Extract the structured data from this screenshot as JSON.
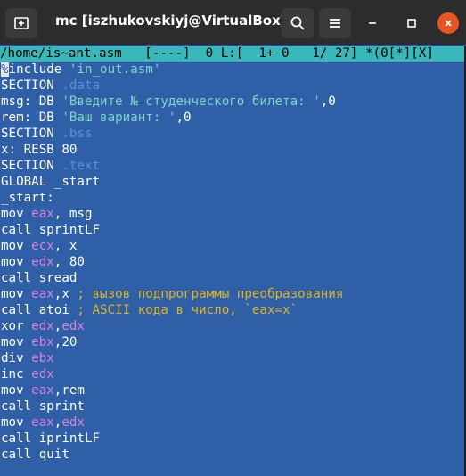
{
  "window": {
    "title": "mc [iszhukovskiyj@VirtualBox]:...",
    "colors": {
      "titlebar": "#2c2c2c",
      "terminal_bg": "#2f5fa6",
      "status_bg": "#3ab7b9",
      "close_btn": "#e95420"
    }
  },
  "titlebar": {
    "new_tab_icon": "new-tab-icon",
    "search_icon": "search-icon",
    "menu_icon": "hamburger-menu-icon",
    "minimize_icon": "minimize-icon",
    "maximize_icon": "maximize-icon",
    "close_icon": "close-icon"
  },
  "editor": {
    "status_line": "/home/is~ant.asm   [----]  0 L:[  1+ 0   1/ 27] *(0[*][X]",
    "lines": [
      [
        {
          "t": "%",
          "c": "cursor"
        },
        {
          "t": "include ",
          "c": "text"
        },
        {
          "t": "'in_out.asm'",
          "c": "str"
        }
      ],
      [
        {
          "t": "SECTION ",
          "c": "text"
        },
        {
          "t": ".data",
          "c": "dir"
        }
      ],
      [
        {
          "t": "msg: DB ",
          "c": "text"
        },
        {
          "t": "'Введите № студенческого билета: '",
          "c": "str"
        },
        {
          "t": ",0",
          "c": "text"
        }
      ],
      [
        {
          "t": "rem: DB ",
          "c": "text"
        },
        {
          "t": "'Ваш вариант: '",
          "c": "str"
        },
        {
          "t": ",0",
          "c": "text"
        }
      ],
      [
        {
          "t": "SECTION ",
          "c": "text"
        },
        {
          "t": ".bss",
          "c": "dir"
        }
      ],
      [
        {
          "t": "x: RESB 80",
          "c": "text"
        }
      ],
      [
        {
          "t": "SECTION ",
          "c": "text"
        },
        {
          "t": ".text",
          "c": "dir"
        }
      ],
      [
        {
          "t": "GLOBAL _start",
          "c": "text"
        }
      ],
      [
        {
          "t": "_start:",
          "c": "text"
        }
      ],
      [
        {
          "t": "mov ",
          "c": "text"
        },
        {
          "t": "eax",
          "c": "reg"
        },
        {
          "t": ", msg",
          "c": "text"
        }
      ],
      [
        {
          "t": "call sprintLF",
          "c": "text"
        }
      ],
      [
        {
          "t": "mov ",
          "c": "text"
        },
        {
          "t": "ecx",
          "c": "reg"
        },
        {
          "t": ", x",
          "c": "text"
        }
      ],
      [
        {
          "t": "mov ",
          "c": "text"
        },
        {
          "t": "edx",
          "c": "reg"
        },
        {
          "t": ", 80",
          "c": "text"
        }
      ],
      [
        {
          "t": "call sread",
          "c": "text"
        }
      ],
      [
        {
          "t": "mov ",
          "c": "text"
        },
        {
          "t": "eax",
          "c": "reg"
        },
        {
          "t": ",x ",
          "c": "text"
        },
        {
          "t": "; вызов подпрограммы преобразования",
          "c": "com"
        }
      ],
      [
        {
          "t": "call atoi ",
          "c": "text"
        },
        {
          "t": "; ASCII кода в число, `eax=x`",
          "c": "com"
        }
      ],
      [
        {
          "t": "xor ",
          "c": "text"
        },
        {
          "t": "edx",
          "c": "reg"
        },
        {
          "t": ",",
          "c": "text"
        },
        {
          "t": "edx",
          "c": "reg"
        }
      ],
      [
        {
          "t": "mov ",
          "c": "text"
        },
        {
          "t": "ebx",
          "c": "reg"
        },
        {
          "t": ",20",
          "c": "text"
        }
      ],
      [
        {
          "t": "div ",
          "c": "text"
        },
        {
          "t": "ebx",
          "c": "reg"
        }
      ],
      [
        {
          "t": "inc ",
          "c": "text"
        },
        {
          "t": "edx",
          "c": "reg"
        }
      ],
      [
        {
          "t": "mov ",
          "c": "text"
        },
        {
          "t": "eax",
          "c": "reg"
        },
        {
          "t": ",rem",
          "c": "text"
        }
      ],
      [
        {
          "t": "call sprint",
          "c": "text"
        }
      ],
      [
        {
          "t": "mov ",
          "c": "text"
        },
        {
          "t": "eax",
          "c": "reg"
        },
        {
          "t": ",",
          "c": "text"
        },
        {
          "t": "edx",
          "c": "reg"
        }
      ],
      [
        {
          "t": "call iprintLF",
          "c": "text"
        }
      ],
      [
        {
          "t": "call quit",
          "c": "text"
        }
      ]
    ]
  }
}
